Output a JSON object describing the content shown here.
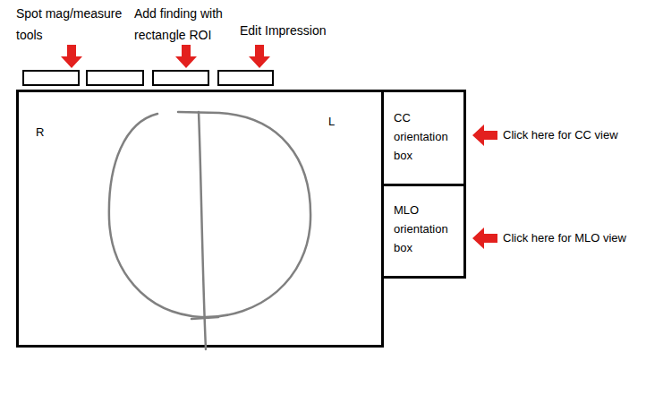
{
  "toolbar": {
    "callouts": [
      {
        "label": "Spot mag/measure tools"
      },
      {
        "label": "Add finding with rectangle ROI"
      },
      {
        "label": "Edit Impression"
      }
    ]
  },
  "viewer": {
    "side_labels": [
      "R",
      "L"
    ]
  },
  "orientation_boxes": [
    {
      "label": "CC orientation box",
      "callout": "Click here for CC view"
    },
    {
      "label": "MLO orientation box",
      "callout": "Click here for MLO view"
    }
  ]
}
